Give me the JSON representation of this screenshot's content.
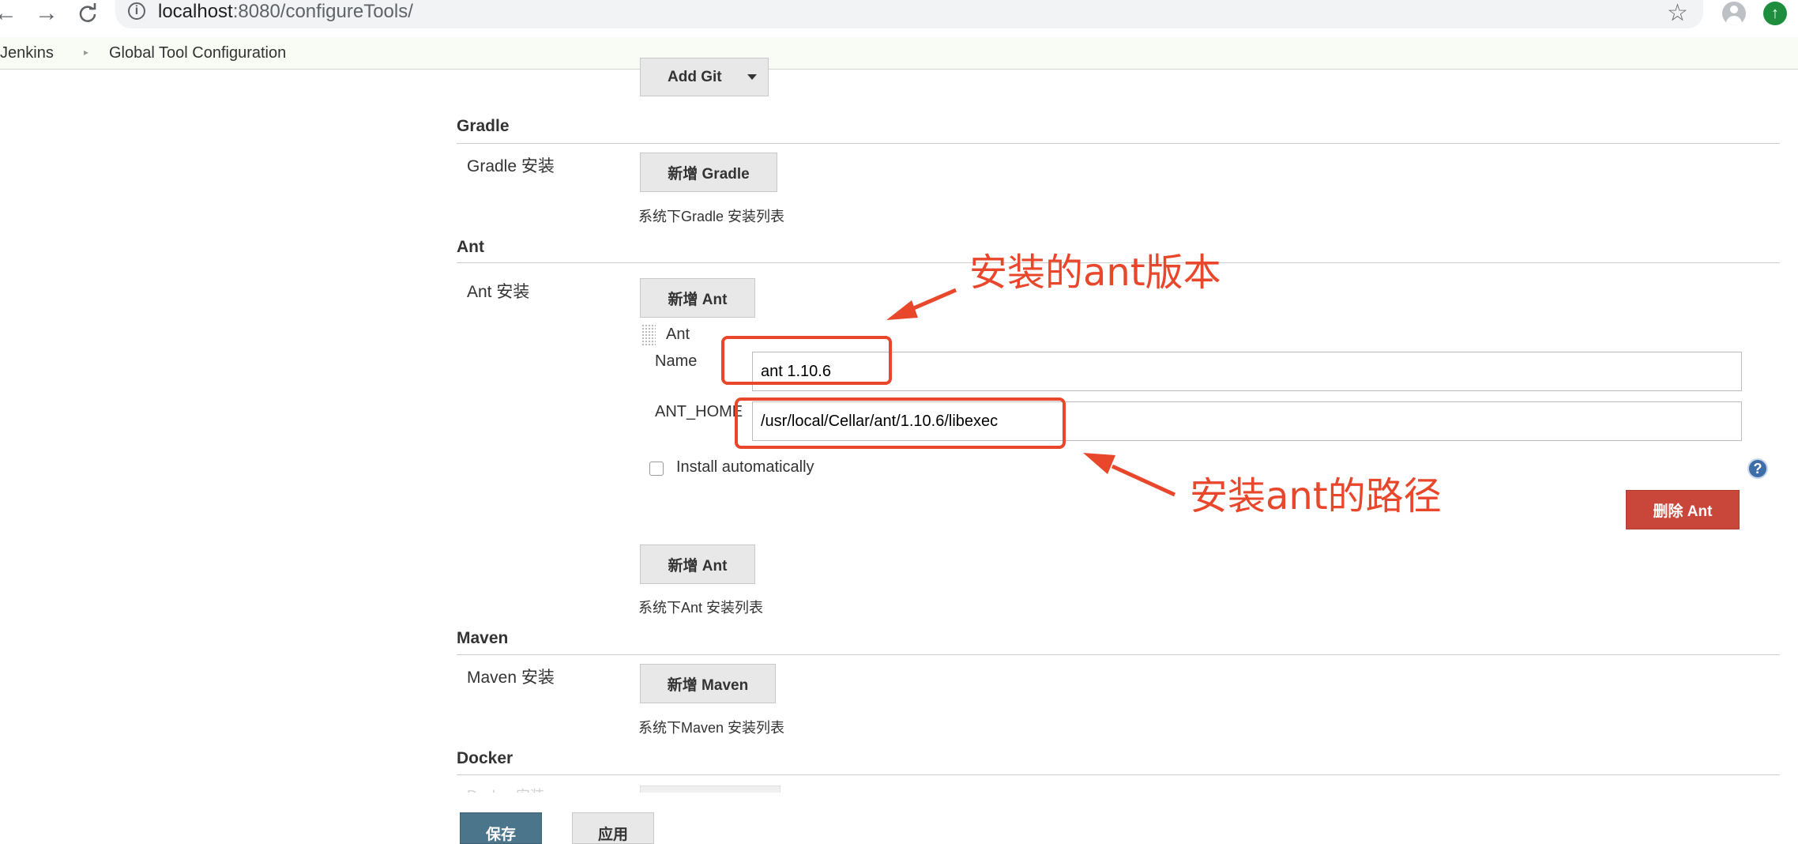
{
  "browser": {
    "back_icon": "←",
    "forward_icon": "→",
    "reload_icon": "C",
    "url_host": "localhost",
    "url_rest": ":8080/configureTools/",
    "info_icon": "i",
    "star_icon": "☆",
    "update_icon": "↑"
  },
  "breadcrumb": {
    "items": [
      "Jenkins",
      "Global Tool Configuration"
    ],
    "separator": "▸"
  },
  "git": {
    "add_button": "Add Git"
  },
  "gradle": {
    "title": "Gradle",
    "label": "Gradle 安装",
    "add_button": "新增 Gradle",
    "description": "系统下Gradle 安装列表"
  },
  "ant": {
    "title": "Ant",
    "label": "Ant 安装",
    "add_button": "新增 Ant",
    "item_header": "Ant",
    "name_label": "Name",
    "name_value": "ant 1.10.6",
    "home_label": "ANT_HOME",
    "home_value": "/usr/local/Cellar/ant/1.10.6/libexec",
    "install_auto_label": "Install automatically",
    "help_icon": "?",
    "delete_button": "删除 Ant",
    "add_button_bottom": "新增 Ant",
    "description": "系统下Ant 安装列表"
  },
  "maven": {
    "title": "Maven",
    "label": "Maven 安装",
    "add_button": "新增 Maven",
    "description": "系统下Maven 安装列表"
  },
  "docker": {
    "title": "Docker",
    "label": "Docker 安装"
  },
  "footer": {
    "save_button": "保存",
    "apply_button": "应用"
  },
  "annotations": {
    "version_note": "安装的ant版本",
    "path_note": "安装ant的路径",
    "color": "#e8472b"
  }
}
